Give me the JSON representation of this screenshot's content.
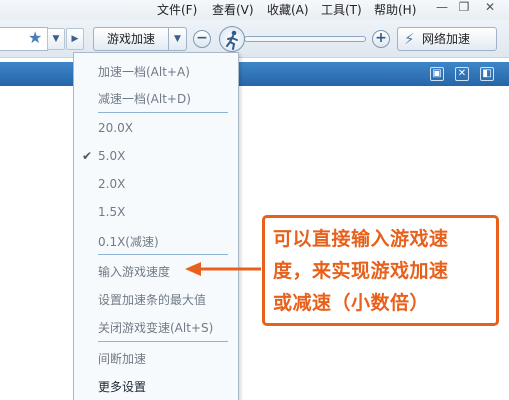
{
  "menubar": {
    "items": [
      "文件(F)",
      "查看(V)",
      "收藏(A)",
      "工具(T)",
      "帮助(H)"
    ],
    "minimize": "—",
    "restore": "❐",
    "close": "✕"
  },
  "toolbar": {
    "game_speed_label": "游戏加速",
    "network_speed_label": "网络加速",
    "minus": "−",
    "plus": "+",
    "favorite_icon": "★"
  },
  "dropdown": {
    "items": [
      {
        "label": "加速一档(Alt+A)",
        "checked": false,
        "dark": false
      },
      {
        "label": "减速一档(Alt+D)",
        "checked": false,
        "dark": false
      },
      {
        "label": "20.0X",
        "checked": false,
        "dark": false
      },
      {
        "label": "5.0X",
        "checked": true,
        "dark": false
      },
      {
        "label": "2.0X",
        "checked": false,
        "dark": false
      },
      {
        "label": "1.5X",
        "checked": false,
        "dark": false
      },
      {
        "label": "0.1X(减速)",
        "checked": false,
        "dark": false
      },
      {
        "label": "输入游戏速度",
        "checked": false,
        "dark": false
      },
      {
        "label": "设置加速条的最大值",
        "checked": false,
        "dark": false
      },
      {
        "label": "关闭游戏变速(Alt+S)",
        "checked": false,
        "dark": false
      },
      {
        "label": "间断加速",
        "checked": false,
        "dark": false
      },
      {
        "label": "更多设置",
        "checked": false,
        "dark": true
      }
    ]
  },
  "callout": {
    "lines": [
      "可以直接输入游戏速",
      "度，来实现游戏加速",
      "或减速（小数倍）"
    ]
  },
  "colors": {
    "accent_orange": "#e8611c",
    "tab_blue": "#2f74b8"
  }
}
